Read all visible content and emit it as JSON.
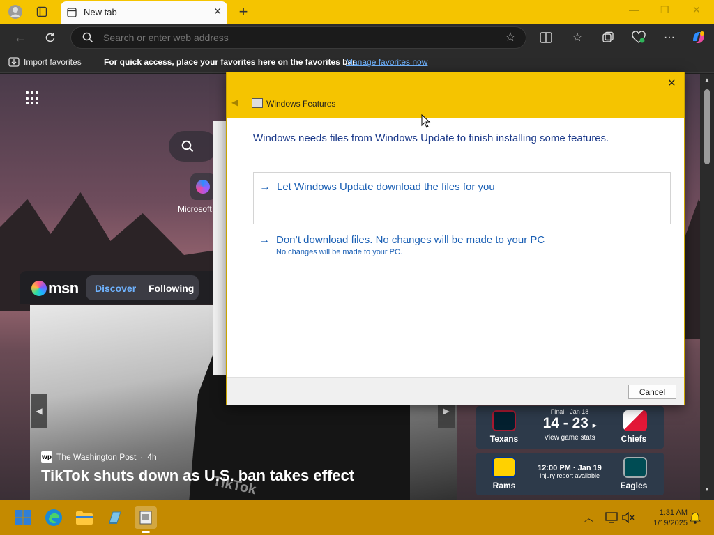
{
  "browser": {
    "tab_title": "New tab",
    "address_placeholder": "Search or enter web address"
  },
  "favorites_bar": {
    "import_label": "Import favorites",
    "message": "For quick access, place your favorites here on the favorites bar.",
    "manage_link": "Manage favorites now"
  },
  "msn": {
    "logo_text": "msn",
    "tabs": [
      "Discover",
      "Following"
    ],
    "quick_link_label": "Microsoft",
    "headline": {
      "source": "The Washington Post",
      "age": "4h",
      "title": "TikTok shuts down as U.S. ban takes effect",
      "image_text": "TikTok"
    },
    "scores": [
      {
        "home": "Texans",
        "away": "Chiefs",
        "status": "Final · Jan 18",
        "score": "14 - 23",
        "detail": "View game stats"
      },
      {
        "home": "Rams",
        "away": "Eagles",
        "status": "12:00 PM · Jan 19",
        "detail": "Injury report available"
      }
    ]
  },
  "dialog": {
    "title": "Windows Features",
    "message": "Windows needs files from Windows Update to finish installing some features.",
    "option1": "Let Windows Update download the files for you",
    "option2": "Don’t download files. No changes will be made to your PC",
    "option2_sub": "No changes will be made to your PC.",
    "cancel_label": "Cancel"
  },
  "taskbar": {
    "time": "1:31 AM",
    "date": "1/19/2025"
  },
  "colors": {
    "accent_yellow": "#f5c400",
    "taskbar": "#c48a00",
    "link_blue": "#1a5fb4"
  }
}
